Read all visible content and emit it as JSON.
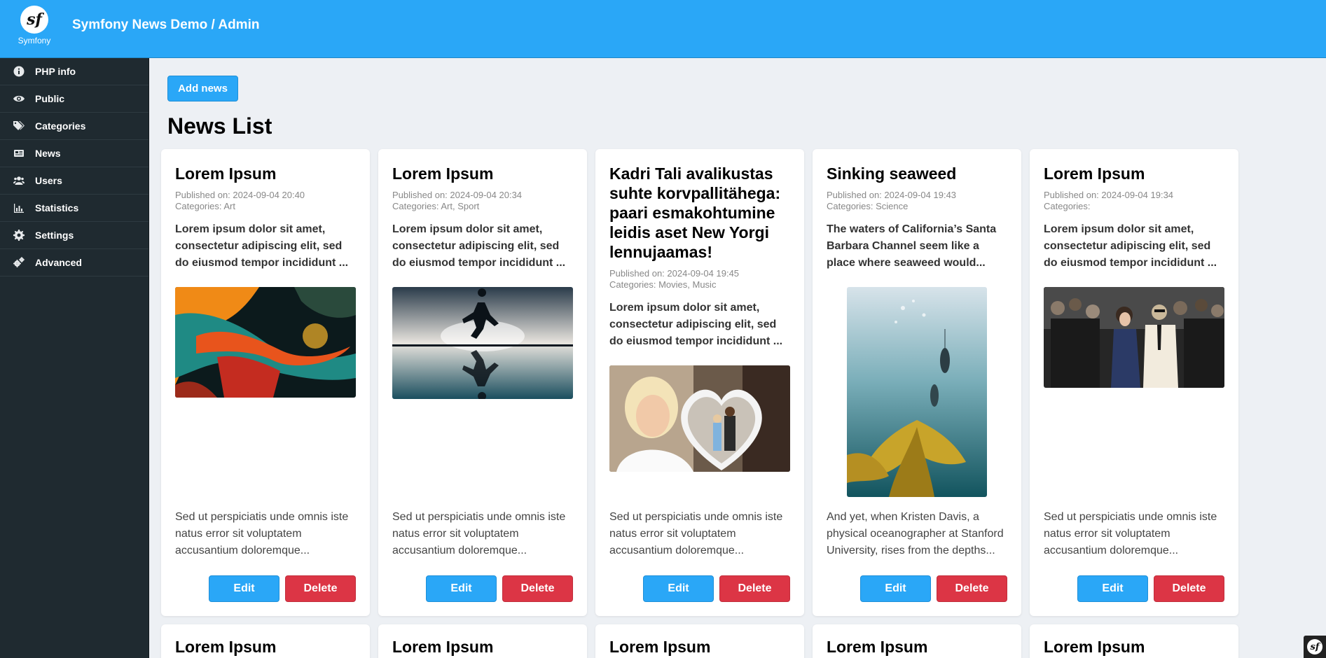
{
  "header": {
    "title": "Symfony News Demo / Admin",
    "logo_text": "Symfony",
    "logo_glyph": "sf"
  },
  "sidebar": {
    "items": [
      {
        "label": "PHP info",
        "icon": "info-icon"
      },
      {
        "label": "Public",
        "icon": "eye-icon"
      },
      {
        "label": "Categories",
        "icon": "tags-icon"
      },
      {
        "label": "News",
        "icon": "newspaper-icon"
      },
      {
        "label": "Users",
        "icon": "users-icon"
      },
      {
        "label": "Statistics",
        "icon": "bar-chart-icon"
      },
      {
        "label": "Settings",
        "icon": "gear-icon"
      },
      {
        "label": "Advanced",
        "icon": "gears-icon"
      }
    ]
  },
  "main": {
    "add_label": "Add news",
    "title": "News List",
    "edit_label": "Edit",
    "delete_label": "Delete",
    "cards": [
      {
        "title": "Lorem Ipsum",
        "published": "Published on: 2024-09-04 20:40",
        "categories": "Categories: Art",
        "lead": "Lorem ipsum dolor sit amet, consectetur adipiscing elit, sed do eiusmod tempor incididunt ...",
        "excerpt": "Sed ut perspiciatis unde omnis iste natus error sit voluptatem accusantium doloremque...",
        "image": "abstract-paint-splash-image"
      },
      {
        "title": "Lorem Ipsum",
        "published": "Published on: 2024-09-04 20:34",
        "categories": "Categories: Art, Sport",
        "lead": "Lorem ipsum dolor sit amet, consectetur adipiscing elit, sed do eiusmod tempor incididunt ...",
        "excerpt": "Sed ut perspiciatis unde omnis iste natus error sit voluptatem accusantium doloremque...",
        "image": "runner-silhouette-image"
      },
      {
        "title": "Kadri Tali avalikustas suhte korvpallitähega: paari esmakohtumine leidis aset New Yorgi lennujaamas!",
        "published": "Published on: 2024-09-04 19:45",
        "categories": "Categories: Movies, Music",
        "lead": "Lorem ipsum dolor sit amet, consectetur adipiscing elit, sed do eiusmod tempor incididunt ...",
        "excerpt": "Sed ut perspiciatis unde omnis iste natus error sit voluptatem accusantium doloremque...",
        "image": "celebrity-couple-heart-image"
      },
      {
        "title": "Sinking seaweed",
        "published": "Published on: 2024-09-04 19:43",
        "categories": "Categories: Science",
        "lead": "The waters of California’s Santa Barbara Channel seem like a place where seaweed would...",
        "excerpt": "And yet, when Kristen Davis, a physical oceanographer at Stanford University, rises from the depths...",
        "image": "underwater-divers-kelp-image"
      },
      {
        "title": "Lorem Ipsum",
        "published": "Published on: 2024-09-04 19:34",
        "categories": "Categories:",
        "lead": "Lorem ipsum dolor sit amet, consectetur adipiscing elit, sed do eiusmod tempor incididunt ...",
        "excerpt": "Sed ut perspiciatis unde omnis iste natus error sit voluptatem accusantium doloremque...",
        "image": "red-carpet-photo-image"
      }
    ],
    "row2_titles": [
      "Lorem Ipsum",
      "Lorem Ipsum",
      "Lorem Ipsum",
      "Lorem Ipsum",
      "Lorem Ipsum"
    ]
  },
  "profiler_badge": "sf",
  "colors": {
    "primary": "#2aa7f7",
    "danger": "#dc3545",
    "sidebar": "#1f2a30",
    "background": "#edf0f4"
  }
}
